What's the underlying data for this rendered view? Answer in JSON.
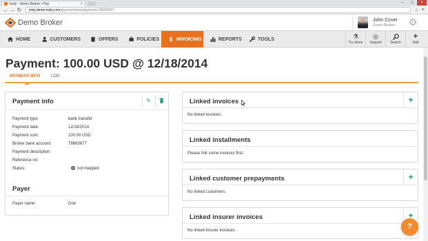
{
  "browser": {
    "tab_title": "Insly - Demo Broker • Pay",
    "url_host": "insly.demo.insly.com",
    "url_path": "/payment/view/payment+10098297"
  },
  "header": {
    "brand": "Demo Broker",
    "user_name": "John Cover",
    "user_company": "Demo Broker"
  },
  "nav": {
    "items": [
      {
        "label": "HOME",
        "icon": "home-icon"
      },
      {
        "label": "CUSTOMERS",
        "icon": "user-icon"
      },
      {
        "label": "OFFERS",
        "icon": "coins-icon"
      },
      {
        "label": "POLICIES",
        "icon": "briefcase-icon"
      },
      {
        "label": "INVOICING",
        "icon": "dollar-icon"
      },
      {
        "label": "REPORTS",
        "icon": "bar-chart-icon"
      },
      {
        "label": "TOOLS",
        "icon": "wrench-icon"
      }
    ],
    "active": "INVOICING",
    "tools": [
      {
        "label": "Try demo",
        "icon": "beaker-icon"
      },
      {
        "label": "Support",
        "icon": "lifebuoy-icon"
      },
      {
        "label": "Search",
        "icon": "search-icon"
      },
      {
        "label": "Add",
        "icon": "plus-icon"
      }
    ]
  },
  "page": {
    "title": "Payment: 100.00 USD @ 12/18/2014",
    "tabs": [
      "PAYMENT INFO",
      "LOG"
    ],
    "active_tab": "PAYMENT INFO"
  },
  "payment_info": {
    "title": "Payment info",
    "fields": [
      {
        "label": "Payment type:",
        "value": "bank transfer"
      },
      {
        "label": "Payment date:",
        "value": "12/18/2014"
      },
      {
        "label": "Payment sum:",
        "value": "100.00 USD"
      },
      {
        "label": "Broker bank account:",
        "value": "78663877"
      },
      {
        "label": "Payment description:",
        "value": ""
      },
      {
        "label": "Reference no:",
        "value": ""
      },
      {
        "label": "Status:",
        "value": "not mapped"
      }
    ]
  },
  "payer": {
    "title": "Payer",
    "label": "Payer name:",
    "value": "Doe"
  },
  "linked_panels": [
    {
      "title": "Linked invoices",
      "text": "No linked invoices."
    },
    {
      "title": "Linked installments",
      "text": "Please link some invoices first."
    },
    {
      "title": "Linked customer prepayments",
      "text": "No linked customers."
    },
    {
      "title": "Linked insurer invoices",
      "text": "No linked insurer invoices."
    }
  ],
  "colors": {
    "accent": "#e8701e",
    "action_green": "#1d9a6c",
    "help_orange": "#f18b2c"
  }
}
